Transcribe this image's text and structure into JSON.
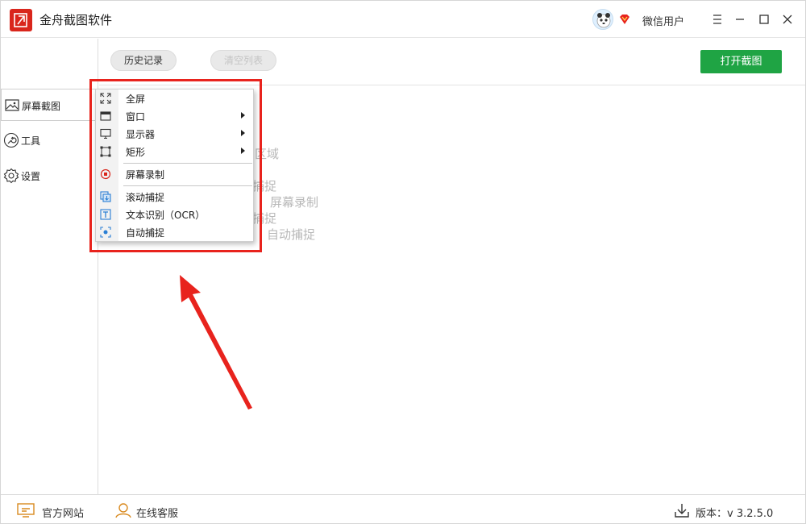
{
  "app": {
    "title": "金舟截图软件",
    "username": "微信用户"
  },
  "colors": {
    "accent_red": "#e8231d",
    "primary_green": "#1fa444",
    "logo_red": "#d9261c"
  },
  "sidebar": {
    "items": [
      {
        "label": "屏幕截图",
        "icon": "image-icon",
        "active": true
      },
      {
        "label": "工具",
        "icon": "wrench-icon",
        "active": false
      },
      {
        "label": "设置",
        "icon": "gear-icon",
        "active": false
      }
    ]
  },
  "toolbar": {
    "history_label": "历史记录",
    "clear_label": "清空列表",
    "open_label": "打开截图"
  },
  "background_hints": [
    "区域",
    "捕捉",
    "屏幕录制",
    "捕捉",
    "自动捕捉"
  ],
  "menu": {
    "items": [
      {
        "label": "全屏",
        "icon": "fullscreen-icon",
        "submenu": false
      },
      {
        "label": "窗口",
        "icon": "window-icon",
        "submenu": true
      },
      {
        "label": "显示器",
        "icon": "monitor-icon",
        "submenu": true
      },
      {
        "label": "矩形",
        "icon": "rectangle-icon",
        "submenu": true
      },
      {
        "label": "屏幕录制",
        "icon": "record-icon",
        "submenu": false
      },
      {
        "label": "滚动捕捉",
        "icon": "scroll-capture-icon",
        "submenu": false
      },
      {
        "label": "文本识别（OCR）",
        "icon": "text-ocr-icon",
        "submenu": false
      },
      {
        "label": "自动捕捉",
        "icon": "auto-capture-icon",
        "submenu": false
      }
    ]
  },
  "footer": {
    "website_label": "官方网站",
    "support_label": "在线客服",
    "version_label": "版本：v 3.2.5.0"
  }
}
